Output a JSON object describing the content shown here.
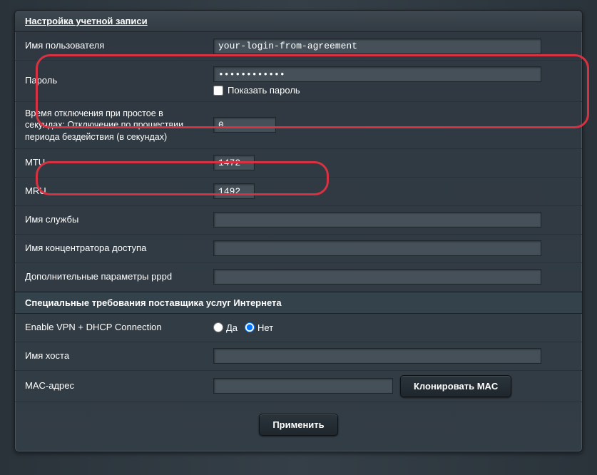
{
  "section1": {
    "title": "Настройка учетной записи"
  },
  "account": {
    "username_label": "Имя пользователя",
    "username_value": "your-login-from-agreement",
    "password_label": "Пароль",
    "password_value": "••••••••••••",
    "show_pw_label": "Показать пароль",
    "idle_label": "Время отключения при простое в секундах: Отключение по прошествии периода бездействия (в секундах)",
    "idle_value": "0",
    "mtu_label": "MTU",
    "mtu_value": "1472",
    "mru_label": "MRU",
    "mru_value": "1492",
    "service_label": "Имя службы",
    "service_value": "",
    "ac_label": "Имя концентратора доступа",
    "ac_value": "",
    "pppd_label": "Дополнительные параметры pppd",
    "pppd_value": ""
  },
  "section2": {
    "title": "Специальные требования поставщика услуг Интернета"
  },
  "isp": {
    "vpn_label": "Enable VPN + DHCP Connection",
    "yes": "Да",
    "no": "Нет",
    "vpn_value": "no",
    "host_label": "Имя хоста",
    "host_value": "",
    "mac_label": "MAC-адрес",
    "mac_value": "",
    "clone_label": "Клонировать MAC"
  },
  "actions": {
    "apply": "Применить"
  }
}
